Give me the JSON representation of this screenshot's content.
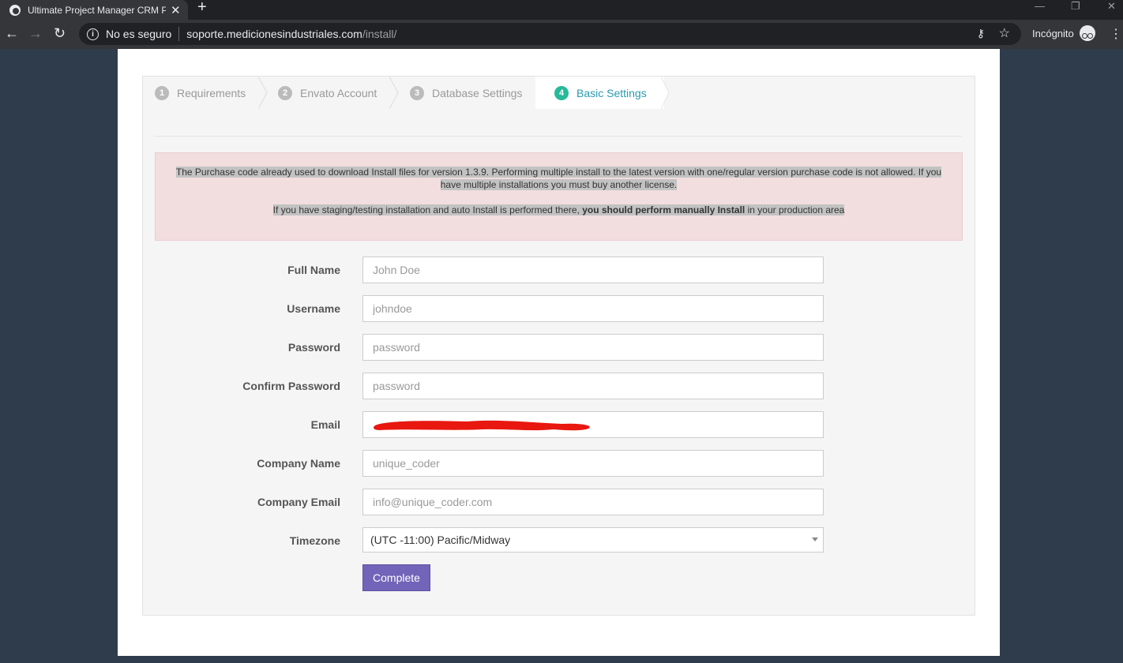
{
  "browser": {
    "tab_title": "Ultimate Project Manager CRM P",
    "new_tab": "+",
    "security_label": "No es seguro",
    "url_host": "soporte.medicionesindustriales.com",
    "url_path": "/install/",
    "incognito_label": "Incógnito"
  },
  "wizard": {
    "steps": [
      {
        "num": "1",
        "label": "Requirements"
      },
      {
        "num": "2",
        "label": "Envato Account"
      },
      {
        "num": "3",
        "label": "Database Settings"
      },
      {
        "num": "4",
        "label": "Basic Settings",
        "active": true
      }
    ]
  },
  "alert": {
    "line1": "The Purchase code already used to download Install files for version 1.3.9. Performing multiple install to the latest version with one/regular version purchase code is not allowed. If you have multiple installations you must buy another license.",
    "line2_prefix": "If you have staging/testing installation and auto Install is performed there, ",
    "line2_bold": "you should perform manually Install",
    "line2_suffix": " in your production area"
  },
  "form": {
    "full_name": {
      "label": "Full Name",
      "placeholder": "John Doe"
    },
    "username": {
      "label": "Username",
      "placeholder": "johndoe"
    },
    "password": {
      "label": "Password",
      "placeholder": "password"
    },
    "confirm_password": {
      "label": "Confirm Password",
      "placeholder": "password"
    },
    "email": {
      "label": "Email"
    },
    "company_name": {
      "label": "Company Name",
      "placeholder": "unique_coder"
    },
    "company_email": {
      "label": "Company Email",
      "placeholder": "info@unique_coder.com"
    },
    "timezone": {
      "label": "Timezone",
      "value": "(UTC -11:00) Pacific/Midway"
    },
    "submit_label": "Complete"
  },
  "colors": {
    "page_bg": "#2e3c4c",
    "active_step_text": "#2a9ab0",
    "active_step_badge": "#26b99a",
    "alert_bg": "#f2dede",
    "button_bg": "#7264b8",
    "redaction": "#e8170f"
  }
}
